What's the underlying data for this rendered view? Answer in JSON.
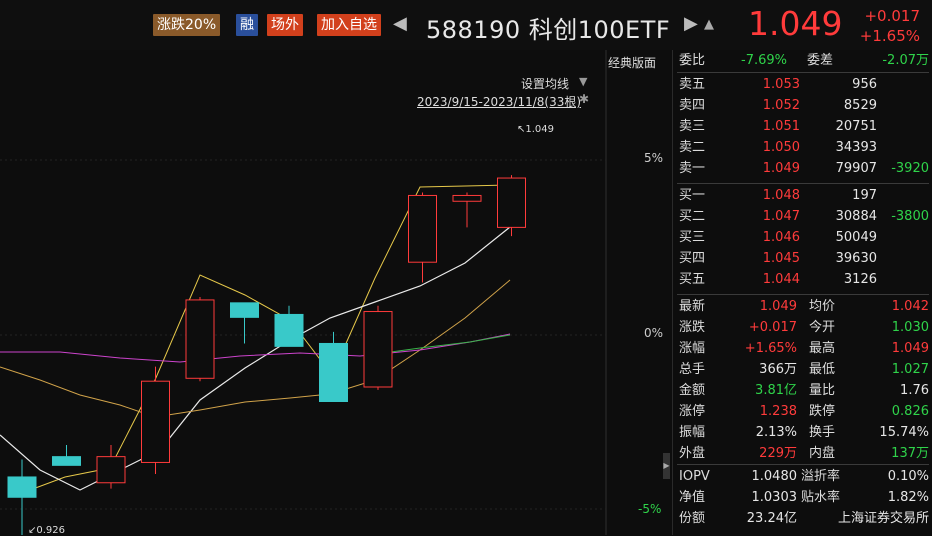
{
  "header": {
    "tag_limit": "涨跌20%",
    "tag_margin": "融",
    "tag_otc": "场外",
    "tag_watch": "加入自选",
    "nav_left": "◀",
    "nav_right": "▶",
    "bell_icon": "bell-icon",
    "code_name": "588190 科创100ETF",
    "price": "1.049",
    "change": "+0.017",
    "change_pct": "+1.65%",
    "colors": {
      "up": "#ff3b3b",
      "down": "#2fd34a"
    }
  },
  "chart": {
    "classic_layout": "经典版面",
    "ma_setting": "设置均线",
    "date_range": "2023/9/15-2023/11/8(33根)",
    "pct_labels": [
      "5%",
      "0%",
      "-5%"
    ],
    "high_annotation": "1.049",
    "low_annotation": "0.926"
  },
  "chart_data": {
    "type": "candlestick",
    "ylim": [
      0.926,
      1.069
    ],
    "candles": [
      {
        "open": 0.946,
        "close": 0.939,
        "high": 0.952,
        "low": 0.926
      },
      {
        "open": 0.953,
        "close": 0.95,
        "high": 0.957,
        "low": 0.95
      },
      {
        "open": 0.944,
        "close": 0.953,
        "high": 0.957,
        "low": 0.942
      },
      {
        "open": 0.951,
        "close": 0.979,
        "high": 0.984,
        "low": 0.947
      },
      {
        "open": 0.98,
        "close": 1.007,
        "high": 1.008,
        "low": 0.979
      },
      {
        "open": 1.006,
        "close": 1.001,
        "high": 1.006,
        "low": 0.992
      },
      {
        "open": 1.002,
        "close": 0.991,
        "high": 1.005,
        "low": 0.991
      },
      {
        "open": 0.992,
        "close": 0.972,
        "high": 0.996,
        "low": 0.972
      },
      {
        "open": 0.977,
        "close": 1.003,
        "high": 1.005,
        "low": 0.976
      },
      {
        "open": 1.02,
        "close": 1.043,
        "high": 1.044,
        "low": 1.013
      },
      {
        "open": 1.041,
        "close": 1.043,
        "high": 1.044,
        "low": 1.032
      },
      {
        "open": 1.032,
        "close": 1.049,
        "high": 1.05,
        "low": 1.029
      }
    ]
  },
  "quote": {
    "weibi_label": "委比",
    "weibi": "-7.69%",
    "weicha_label": "委差",
    "weicha": "-2.07万",
    "asks": [
      {
        "label": "卖五",
        "price": "1.053",
        "vol": "956",
        "chg": ""
      },
      {
        "label": "卖四",
        "price": "1.052",
        "vol": "8529",
        "chg": ""
      },
      {
        "label": "卖三",
        "price": "1.051",
        "vol": "20751",
        "chg": ""
      },
      {
        "label": "卖二",
        "price": "1.050",
        "vol": "34393",
        "chg": ""
      },
      {
        "label": "卖一",
        "price": "1.049",
        "vol": "79907",
        "chg": "-3920"
      }
    ],
    "bids": [
      {
        "label": "买一",
        "price": "1.048",
        "vol": "197",
        "chg": ""
      },
      {
        "label": "买二",
        "price": "1.047",
        "vol": "30884",
        "chg": "-3800"
      },
      {
        "label": "买三",
        "price": "1.046",
        "vol": "50049",
        "chg": ""
      },
      {
        "label": "买四",
        "price": "1.045",
        "vol": "39630",
        "chg": ""
      },
      {
        "label": "买五",
        "price": "1.044",
        "vol": "3126",
        "chg": ""
      }
    ],
    "stats": [
      {
        "l1": "最新",
        "v1": "1.049",
        "c1": "red",
        "l2": "均价",
        "v2": "1.042",
        "c2": "red"
      },
      {
        "l1": "涨跌",
        "v1": "+0.017",
        "c1": "red",
        "l2": "今开",
        "v2": "1.030",
        "c2": "green"
      },
      {
        "l1": "涨幅",
        "v1": "+1.65%",
        "c1": "red",
        "l2": "最高",
        "v2": "1.049",
        "c2": "red"
      },
      {
        "l1": "总手",
        "v1": "366万",
        "c1": "white",
        "l2": "最低",
        "v2": "1.027",
        "c2": "green"
      },
      {
        "l1": "金额",
        "v1": "3.81亿",
        "c1": "green",
        "l2": "量比",
        "v2": "1.76",
        "c2": "white"
      },
      {
        "l1": "涨停",
        "v1": "1.238",
        "c1": "red",
        "l2": "跌停",
        "v2": "0.826",
        "c2": "green"
      },
      {
        "l1": "振幅",
        "v1": "2.13%",
        "c1": "white",
        "l2": "换手",
        "v2": "15.74%",
        "c2": "white"
      },
      {
        "l1": "外盘",
        "v1": "229万",
        "c1": "red",
        "l2": "内盘",
        "v2": "137万",
        "c2": "green"
      }
    ],
    "extra": [
      {
        "l1": "IOPV",
        "v1": "1.0480",
        "l2": "溢折率",
        "v2": "0.10%"
      },
      {
        "l1": "净值",
        "v1": "1.0303",
        "l2": "贴水率",
        "v2": "1.82%"
      },
      {
        "l1": "份额",
        "v1": "23.24亿",
        "l2": "",
        "v2": "上海证券交易所"
      }
    ]
  }
}
